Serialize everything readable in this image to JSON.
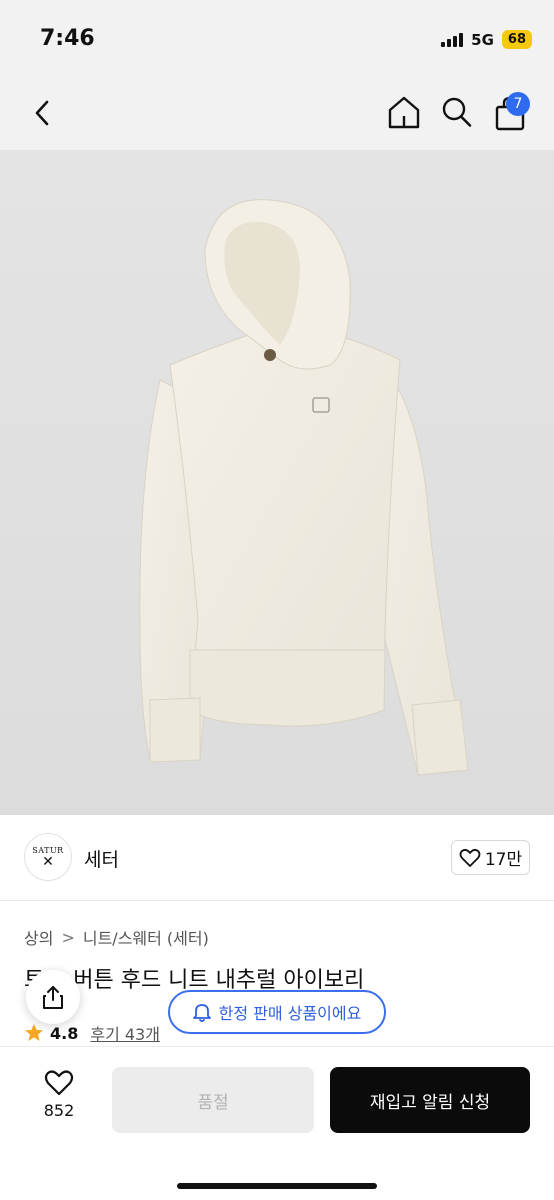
{
  "status_bar": {
    "time": "7:46",
    "network": "5G",
    "battery": "68"
  },
  "nav": {
    "back_icon": "chevron-left-icon",
    "home_icon": "home-icon",
    "search_icon": "search-icon",
    "cart_icon": "shopping-bag-icon",
    "cart_badge": "7",
    "accent_color": "#2f6bf0"
  },
  "product_image": {
    "subject": "ivory knit hoodie sweater",
    "icon": "product-photo"
  },
  "brand": {
    "logo_text": "SATUR",
    "name": "세터",
    "like_label": "17만",
    "like_icon": "heart-outline-icon"
  },
  "breadcrumb": {
    "items": [
      "상의",
      "니트/스웨터 (세터)"
    ],
    "separator": ">"
  },
  "product": {
    "title": "토… 버튼 후드 니트 내추럴 아이보리",
    "rating": "4.8",
    "review_link": "후기 43개",
    "star_color": "#f5a623"
  },
  "overlay": {
    "share_icon": "share-icon",
    "limited_label": "한정 판매 상품이에요",
    "limited_icon": "bell-icon",
    "limited_color": "#3b6ef0"
  },
  "bottom_bar": {
    "wish_count": "852",
    "wish_icon": "heart-outline-icon",
    "soldout_label": "품절",
    "restock_label": "재입고 알림 신청"
  }
}
